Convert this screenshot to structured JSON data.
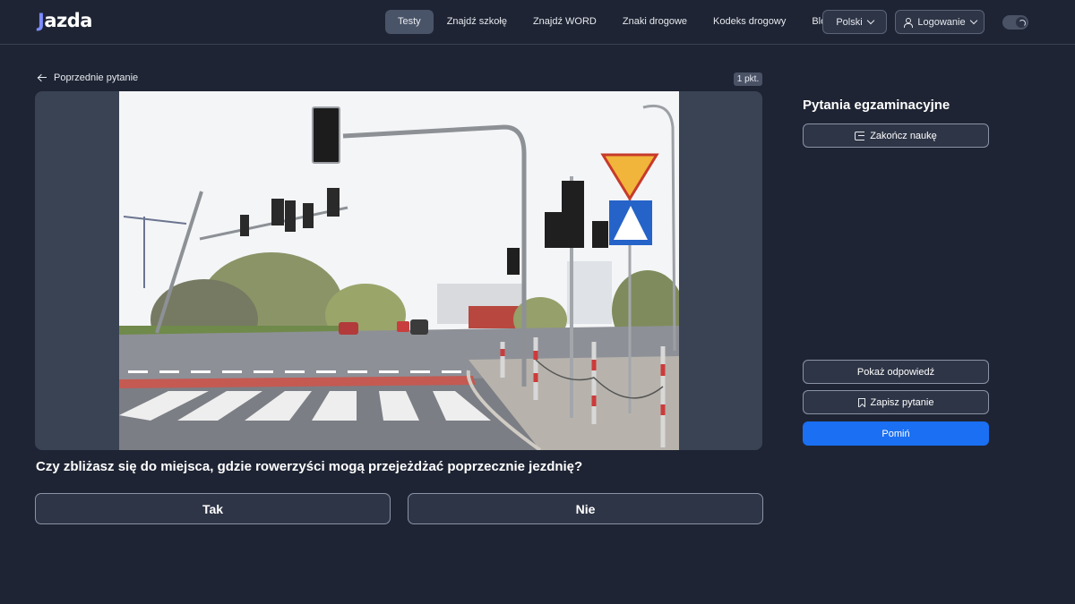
{
  "header": {
    "logo_mark": "J",
    "logo_text": "azda",
    "nav": [
      "Testy",
      "Znajdź szkołę",
      "Znajdź WORD",
      "Znaki drogowe",
      "Kodeks drogowy",
      "Blog"
    ],
    "active_nav": "Testy",
    "language": "Polski",
    "login": "Logowanie",
    "theme_toggle_icon": "moon-icon"
  },
  "question": {
    "prev_label": "Poprzednie pytanie",
    "points": "1 pkt.",
    "text": "Czy zbliżasz się do miejsca, gdzie rowerzyści mogą przejeżdżać poprzecznie jezdnię?",
    "answers": [
      "Tak",
      "Nie"
    ]
  },
  "side": {
    "title": "Pytania egzaminacyjne",
    "finish": "Zakończ naukę",
    "show_answer": "Pokaż odpowiedź",
    "save_question": "Zapisz pytanie",
    "skip": "Pomiń"
  },
  "colors": {
    "background": "#1e2433",
    "accent": "#1a6ff2",
    "nav_active": "#4a5468"
  }
}
